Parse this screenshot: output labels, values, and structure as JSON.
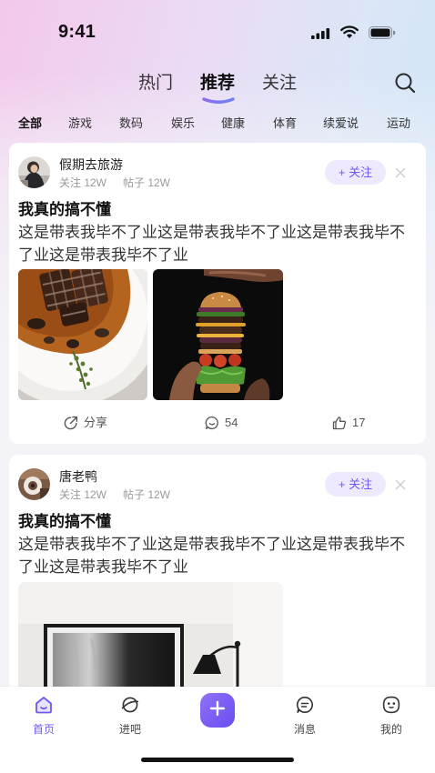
{
  "status_bar": {
    "time": "9:41",
    "icons": [
      "cellular-signal-icon",
      "wifi-icon",
      "battery-icon"
    ]
  },
  "header": {
    "tabs": [
      {
        "label": "热门",
        "active": false
      },
      {
        "label": "推荐",
        "active": true
      },
      {
        "label": "关注",
        "active": false
      }
    ],
    "search_icon": "search-icon"
  },
  "categories": [
    {
      "label": "全部",
      "active": true
    },
    {
      "label": "游戏",
      "active": false
    },
    {
      "label": "数码",
      "active": false
    },
    {
      "label": "娱乐",
      "active": false
    },
    {
      "label": "健康",
      "active": false
    },
    {
      "label": "体育",
      "active": false
    },
    {
      "label": "续爱说",
      "active": false
    },
    {
      "label": "运动",
      "active": false
    }
  ],
  "posts": [
    {
      "author": "假期去旅游",
      "stats": {
        "following": "关注 12W",
        "posts": "帖子 12W"
      },
      "follow_button": "+ 关注",
      "title": "我真的搞不懂",
      "body": "这是带表我毕不了业这是带表我毕不了业这是带表我毕不了业这是带表我毕不了业",
      "images": [
        "steak-dish-photo",
        "burger-stack-photo"
      ],
      "actions": {
        "share": "分享",
        "comments": "54",
        "likes": "17"
      }
    },
    {
      "author": "唐老鸭",
      "stats": {
        "following": "关注 12W",
        "posts": "帖子 12W"
      },
      "follow_button": "+ 关注",
      "title": "我真的搞不懂",
      "body": "这是带表我毕不了业这是带表我毕不了业这是带表我毕不了业这是带表我毕不了业",
      "images": [
        "interior-wall-art-photo"
      ]
    }
  ],
  "tab_bar": {
    "items": [
      {
        "label": "首页",
        "icon": "home-icon",
        "active": true
      },
      {
        "label": "进吧",
        "icon": "planet-icon",
        "active": false
      },
      {
        "icon": "plus-icon"
      },
      {
        "label": "消息",
        "icon": "message-icon",
        "active": false
      },
      {
        "label": "我的",
        "icon": "profile-icon",
        "active": false
      }
    ]
  },
  "colors": {
    "accent": "#7357f0",
    "follow_button_bg": "#eee9fd",
    "page_bg": "#f4f3f8",
    "text_primary": "#1c1c1e",
    "text_secondary": "#9a9a9a"
  }
}
